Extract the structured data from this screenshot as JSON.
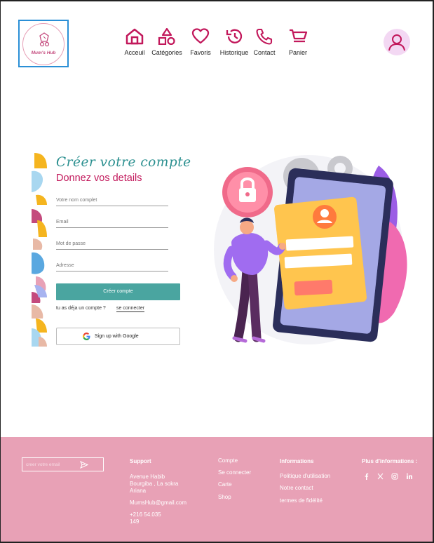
{
  "header": {
    "logo_text": "Mum's Hub",
    "nav": [
      {
        "label": "Acceuil",
        "icon": "home-icon"
      },
      {
        "label": "Catégories",
        "icon": "shapes-icon"
      },
      {
        "label": "Favoris",
        "icon": "heart-icon"
      },
      {
        "label": "Historique",
        "icon": "history-icon"
      },
      {
        "label": "Contact",
        "icon": "phone-icon"
      },
      {
        "label": "Panier",
        "icon": "cart-icon"
      }
    ],
    "accent_color": "#c2185b"
  },
  "form": {
    "title": "Créer votre compte",
    "subtitle": "Donnez vos details",
    "fields": {
      "name": "Votre nom complet",
      "email": "Email",
      "password": "Mot de passe",
      "address": "Adresse"
    },
    "create_button": "Créer compte",
    "have_account": "tu as déja un compte ?",
    "login_link": "se connecter",
    "google_button": "Sign up with Google",
    "button_color": "#4aa5a0"
  },
  "footer": {
    "newsletter_placeholder": "creer votre email",
    "support": {
      "title": "Support",
      "address_1": "Avenue Habib",
      "address_2": "Bourgiba , La sokra",
      "address_3": "Ariana",
      "email": "MumsHub@gmail.com",
      "phone_1": "+216 54.035",
      "phone_2": "149"
    },
    "compte": {
      "title": "Compte",
      "links": [
        "Se connecter",
        "Carte",
        "Shop"
      ]
    },
    "informations": {
      "title": "Informations",
      "links": [
        "Politique d'utilisation",
        "Notre contact",
        "termes de fidélité"
      ]
    },
    "plus": {
      "title": "Plus d'informations :",
      "socials": [
        "facebook-icon",
        "x-icon",
        "instagram-icon",
        "linkedin-icon"
      ]
    },
    "background": "#e8a1b6"
  }
}
